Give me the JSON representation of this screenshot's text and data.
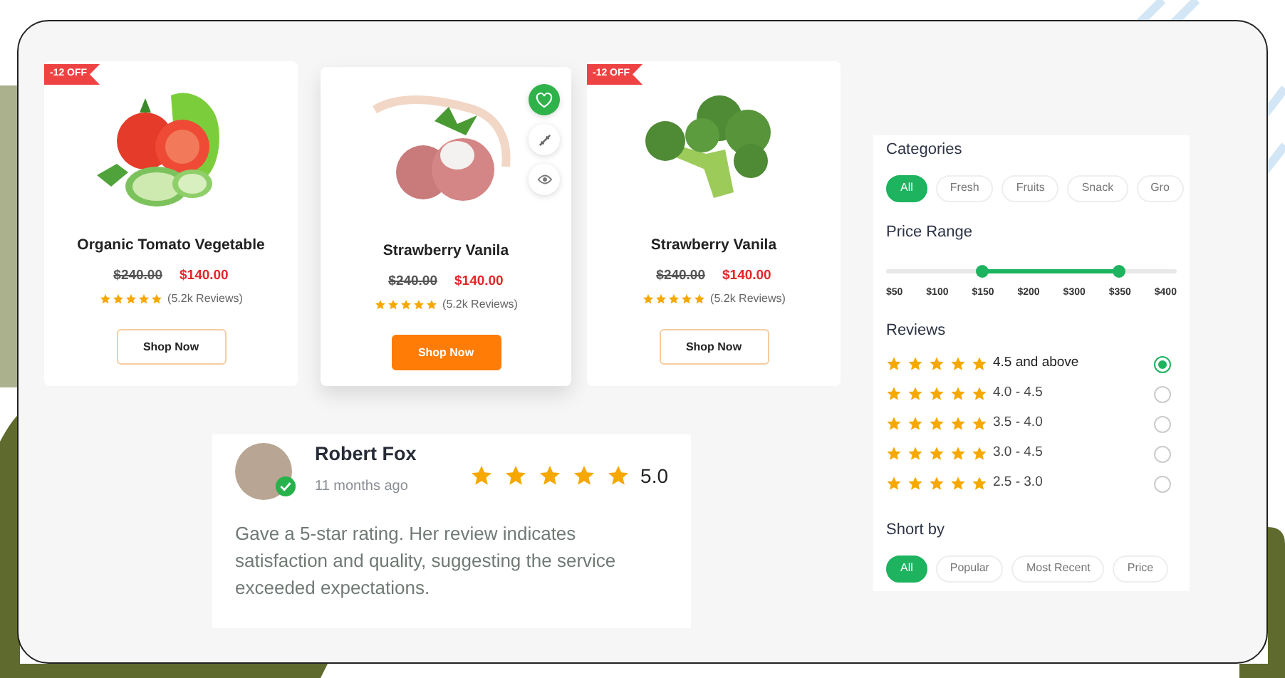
{
  "products": [
    {
      "badge": "-12 OFF",
      "kind": "tomato",
      "name": "Organic Tomato Vegetable",
      "old_price": "$240.00",
      "price": "$140.00",
      "stars": 5,
      "reviews": "(5.2k Reviews)",
      "button": "Shop Now",
      "highlighted": false
    },
    {
      "kind": "lychee",
      "name": "Strawberry Vanila",
      "old_price": "$240.00",
      "price": "$140.00",
      "stars": 5,
      "reviews": "(5.2k Reviews)",
      "button": "Shop Now",
      "highlighted": true
    },
    {
      "badge": "-12 OFF",
      "kind": "broccoli",
      "name": "Strawberry Vanila",
      "old_price": "$240.00",
      "price": "$140.00",
      "stars": 5,
      "reviews": "(5.2k Reviews)",
      "button": "Shop Now",
      "highlighted": false
    }
  ],
  "review": {
    "name": "Robert Fox",
    "time": "11 months ago",
    "verified": true,
    "stars": 5,
    "rating": "5.0",
    "text": "Gave a 5-star rating. Her review indicates satisfaction and quality, suggesting the service exceeded expectations."
  },
  "filters": {
    "categories": {
      "title": "Categories",
      "chips": [
        {
          "label": "All",
          "selected": true
        },
        {
          "label": "Fresh",
          "selected": false
        },
        {
          "label": "Fruits",
          "selected": false
        },
        {
          "label": "Snack",
          "selected": false
        },
        {
          "label": "Gro",
          "selected": false
        }
      ]
    },
    "price_range": {
      "title": "Price Range",
      "low_thumb": {
        "level": 0.33
      },
      "high_thumb": {
        "level": 0.8
      },
      "ticks": [
        "$50",
        "$100",
        "$150",
        "$200",
        "$300",
        "$350",
        "$400"
      ]
    },
    "reviews": {
      "title": "Reviews",
      "options": [
        {
          "stars": 5,
          "label": "4.5 and above",
          "selected": true
        },
        {
          "stars": 5,
          "label": "4.0 - 4.5",
          "selected": false
        },
        {
          "stars": 5,
          "label": "3.5 - 4.0",
          "selected": false
        },
        {
          "stars": 5,
          "label": "3.0 - 4.5",
          "selected": false
        },
        {
          "stars": 5,
          "label": "2.5 - 3.0",
          "selected": false
        }
      ]
    },
    "sort": {
      "title": "Short by",
      "chips": [
        {
          "label": "All",
          "selected": true
        },
        {
          "label": "Popular",
          "selected": false
        },
        {
          "label": "Most Recent",
          "selected": false
        },
        {
          "label": "Price",
          "selected": false
        }
      ]
    }
  }
}
